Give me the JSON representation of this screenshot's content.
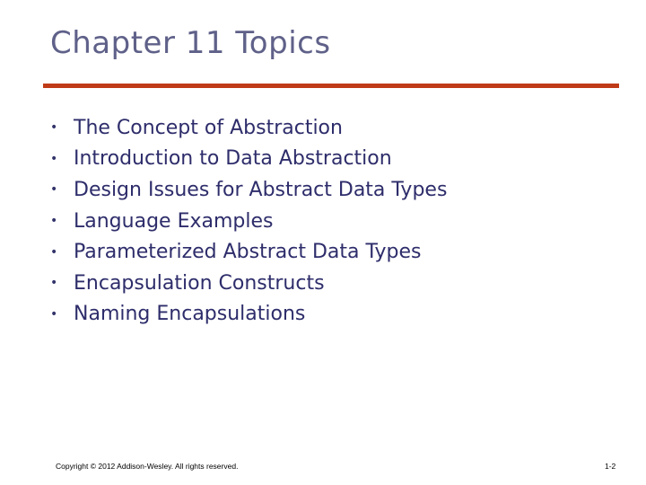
{
  "slide": {
    "title": "Chapter 11 Topics",
    "bullet_glyph": "•",
    "items": [
      "The Concept of Abstraction",
      "Introduction to Data Abstraction",
      "Design Issues for Abstract Data Types",
      "Language Examples",
      "Parameterized Abstract Data Types",
      "Encapsulation Constructs",
      "Naming Encapsulations"
    ],
    "footer": "Copyright © 2012 Addison-Wesley. All rights reserved.",
    "page_number": "1-2"
  },
  "colors": {
    "title": "#5f6189",
    "rule": "#bf3a17",
    "body_text": "#2e2d6b"
  }
}
